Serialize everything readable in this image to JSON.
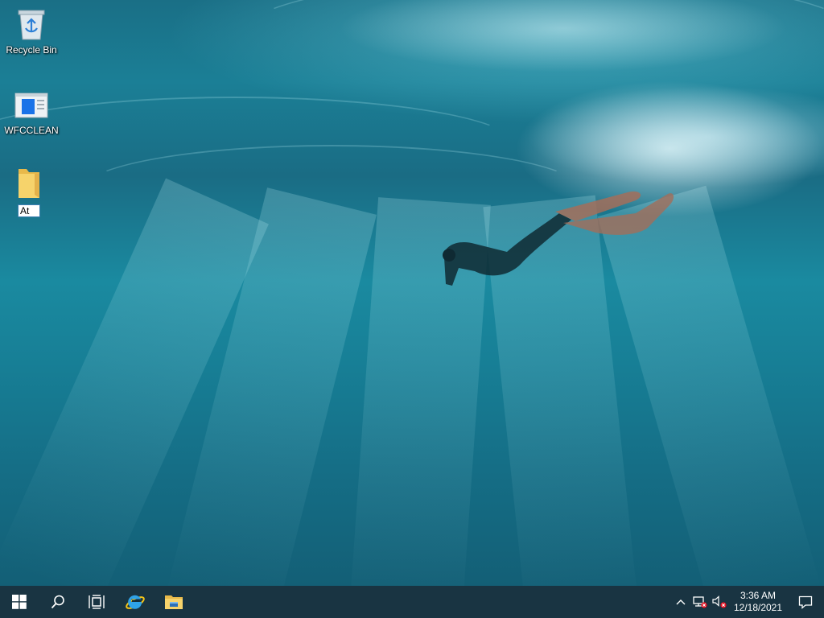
{
  "desktop": {
    "icons": [
      {
        "label": "Recycle Bin",
        "icon": "recycle-bin-icon"
      },
      {
        "label": "WFCCLEAN",
        "icon": "window-shortcut-icon"
      },
      {
        "label": "",
        "icon": "folder-icon",
        "rename_value": "At"
      }
    ]
  },
  "taskbar": {
    "buttons": [
      {
        "name": "start-button",
        "icon": "windows-logo-icon"
      },
      {
        "name": "search-button",
        "icon": "search-icon"
      },
      {
        "name": "task-view-button",
        "icon": "task-view-icon"
      },
      {
        "name": "internet-explorer-button",
        "icon": "internet-explorer-icon"
      },
      {
        "name": "file-explorer-button",
        "icon": "file-explorer-icon"
      }
    ],
    "tray": {
      "show_hidden_icon": "chevron-up-icon",
      "network_icon": "network-disconnected-icon",
      "volume_icon": "volume-muted-icon",
      "time": "3:36 AM",
      "date": "12/18/2021",
      "notifications_icon": "action-center-icon"
    }
  },
  "colors": {
    "accent": "#1a73e8",
    "taskbar": "#102c3a",
    "wallpaper": "#1a7f96"
  }
}
